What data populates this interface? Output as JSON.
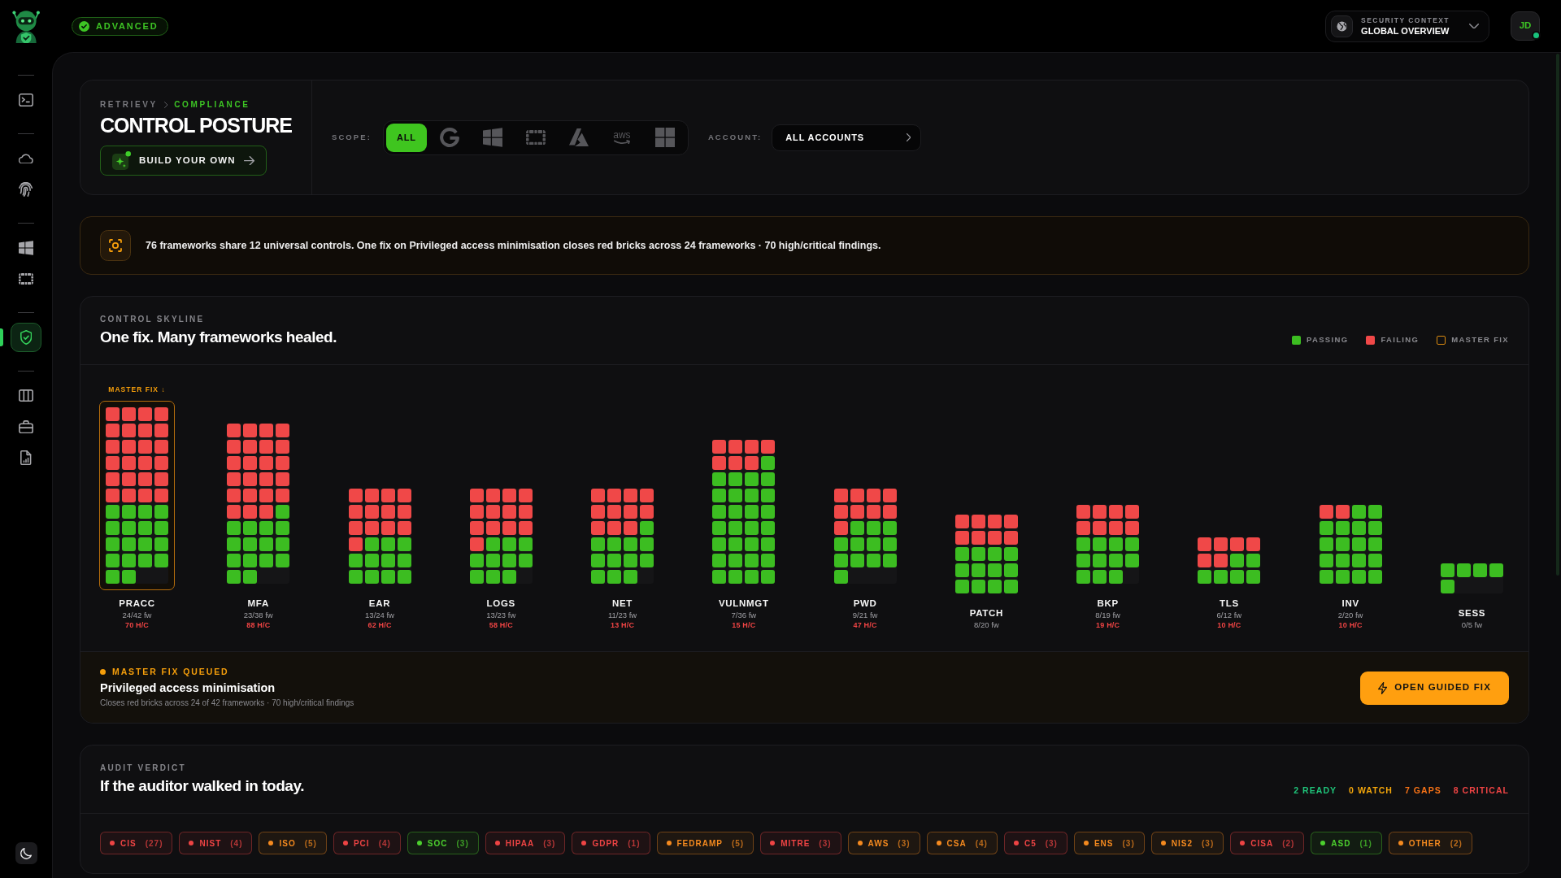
{
  "topbar": {
    "badge": "ADVANCED",
    "context": {
      "label": "SECURITY CONTEXT",
      "value": "GLOBAL OVERVIEW"
    },
    "user": {
      "initials": "JD",
      "online": true
    }
  },
  "sidebar": {
    "groups": [
      {
        "items": [
          {
            "kind": "terminal",
            "selected": false
          }
        ]
      },
      {
        "items": [
          {
            "kind": "cloud",
            "selected": false
          },
          {
            "kind": "fingerprint",
            "selected": false
          }
        ]
      },
      {
        "items": [
          {
            "kind": "panes",
            "selected": false
          },
          {
            "kind": "frame",
            "selected": false
          }
        ]
      },
      {
        "items": [
          {
            "kind": "shield",
            "selected": true
          }
        ]
      },
      {
        "items": [
          {
            "kind": "columns",
            "selected": false
          },
          {
            "kind": "briefcase",
            "selected": false
          },
          {
            "kind": "report",
            "selected": false
          }
        ]
      }
    ]
  },
  "header": {
    "breadcrumb": [
      {
        "label": "RETRIEVY",
        "current": false
      },
      {
        "label": "COMPLIANCE",
        "current": true
      }
    ],
    "title": "CONTROL POSTURE",
    "build_button": "BUILD YOUR OWN",
    "scope": {
      "label": "SCOPE:",
      "options": [
        {
          "kind": "all",
          "label": "ALL",
          "selected": true
        },
        {
          "kind": "g",
          "selected": false
        },
        {
          "kind": "panes",
          "selected": false
        },
        {
          "kind": "frame",
          "selected": false
        },
        {
          "kind": "peak",
          "selected": false
        },
        {
          "kind": "smile",
          "label": "aws",
          "selected": false
        },
        {
          "kind": "squares",
          "selected": false
        }
      ]
    },
    "account": {
      "label": "ACCOUNT:",
      "value": "ALL ACCOUNTS"
    }
  },
  "insight": {
    "text": "76 frameworks share 12 universal controls. One fix on Privileged access minimisation closes red bricks across 24 frameworks · 70 high/critical findings."
  },
  "skyline": {
    "eyebrow": "CONTROL SKYLINE",
    "title": "One fix. Many frameworks healed.",
    "legend": [
      {
        "label": "PASSING",
        "kind": "passing"
      },
      {
        "label": "FAILING",
        "kind": "failing"
      },
      {
        "label": "MASTER FIX",
        "kind": "master_fix"
      }
    ],
    "master_fix_tag": "MASTER FIX ↓",
    "controls": [
      {
        "code": "PRACC",
        "frameworks": "24/42 fw",
        "findings": "70 H/C",
        "master_fix": true,
        "bricks": [
          {
            "failing": true
          },
          {
            "failing": true
          },
          {
            "failing": true
          },
          {
            "failing": true
          },
          {
            "failing": true
          },
          {
            "failing": true
          },
          {
            "failing": true
          },
          {
            "failing": true
          },
          {
            "failing": true
          },
          {
            "failing": true
          },
          {
            "failing": true
          },
          {
            "failing": true
          },
          {
            "failing": true
          },
          {
            "failing": true
          },
          {
            "failing": true
          },
          {
            "failing": true
          },
          {
            "failing": true
          },
          {
            "failing": true
          },
          {
            "failing": true
          },
          {
            "failing": true
          },
          {
            "failing": true
          },
          {
            "failing": true
          },
          {
            "failing": true
          },
          {
            "failing": true
          },
          {
            "failing": false
          },
          {
            "failing": false
          },
          {
            "failing": false
          },
          {
            "failing": false
          },
          {
            "failing": false
          },
          {
            "failing": false
          },
          {
            "failing": false
          },
          {
            "failing": false
          },
          {
            "failing": false
          },
          {
            "failing": false
          },
          {
            "failing": false
          },
          {
            "failing": false
          },
          {
            "failing": false
          },
          {
            "failing": false
          },
          {
            "failing": false
          },
          {
            "failing": false
          },
          {
            "failing": false
          },
          {
            "failing": false
          }
        ]
      },
      {
        "code": "MFA",
        "frameworks": "23/38 fw",
        "findings": "88 H/C",
        "master_fix": false,
        "bricks": [
          {
            "failing": true
          },
          {
            "failing": true
          },
          {
            "failing": true
          },
          {
            "failing": true
          },
          {
            "failing": true
          },
          {
            "failing": true
          },
          {
            "failing": true
          },
          {
            "failing": true
          },
          {
            "failing": true
          },
          {
            "failing": true
          },
          {
            "failing": true
          },
          {
            "failing": true
          },
          {
            "failing": true
          },
          {
            "failing": true
          },
          {
            "failing": true
          },
          {
            "failing": true
          },
          {
            "failing": true
          },
          {
            "failing": true
          },
          {
            "failing": true
          },
          {
            "failing": true
          },
          {
            "failing": true
          },
          {
            "failing": true
          },
          {
            "failing": true
          },
          {
            "failing": false
          },
          {
            "failing": false
          },
          {
            "failing": false
          },
          {
            "failing": false
          },
          {
            "failing": false
          },
          {
            "failing": false
          },
          {
            "failing": false
          },
          {
            "failing": false
          },
          {
            "failing": false
          },
          {
            "failing": false
          },
          {
            "failing": false
          },
          {
            "failing": false
          },
          {
            "failing": false
          },
          {
            "failing": false
          },
          {
            "failing": false
          }
        ]
      },
      {
        "code": "EAR",
        "frameworks": "13/24 fw",
        "findings": "62 H/C",
        "master_fix": false,
        "bricks": [
          {
            "failing": true
          },
          {
            "failing": true
          },
          {
            "failing": true
          },
          {
            "failing": true
          },
          {
            "failing": true
          },
          {
            "failing": true
          },
          {
            "failing": true
          },
          {
            "failing": true
          },
          {
            "failing": true
          },
          {
            "failing": true
          },
          {
            "failing": true
          },
          {
            "failing": true
          },
          {
            "failing": true
          },
          {
            "failing": false
          },
          {
            "failing": false
          },
          {
            "failing": false
          },
          {
            "failing": false
          },
          {
            "failing": false
          },
          {
            "failing": false
          },
          {
            "failing": false
          },
          {
            "failing": false
          },
          {
            "failing": false
          },
          {
            "failing": false
          },
          {
            "failing": false
          }
        ]
      },
      {
        "code": "LOGS",
        "frameworks": "13/23 fw",
        "findings": "58 H/C",
        "master_fix": false,
        "bricks": [
          {
            "failing": true
          },
          {
            "failing": true
          },
          {
            "failing": true
          },
          {
            "failing": true
          },
          {
            "failing": true
          },
          {
            "failing": true
          },
          {
            "failing": true
          },
          {
            "failing": true
          },
          {
            "failing": true
          },
          {
            "failing": true
          },
          {
            "failing": true
          },
          {
            "failing": true
          },
          {
            "failing": true
          },
          {
            "failing": false
          },
          {
            "failing": false
          },
          {
            "failing": false
          },
          {
            "failing": false
          },
          {
            "failing": false
          },
          {
            "failing": false
          },
          {
            "failing": false
          },
          {
            "failing": false
          },
          {
            "failing": false
          },
          {
            "failing": false
          }
        ]
      },
      {
        "code": "NET",
        "frameworks": "11/23 fw",
        "findings": "13 H/C",
        "master_fix": false,
        "bricks": [
          {
            "failing": true
          },
          {
            "failing": true
          },
          {
            "failing": true
          },
          {
            "failing": true
          },
          {
            "failing": true
          },
          {
            "failing": true
          },
          {
            "failing": true
          },
          {
            "failing": true
          },
          {
            "failing": true
          },
          {
            "failing": true
          },
          {
            "failing": true
          },
          {
            "failing": false
          },
          {
            "failing": false
          },
          {
            "failing": false
          },
          {
            "failing": false
          },
          {
            "failing": false
          },
          {
            "failing": false
          },
          {
            "failing": false
          },
          {
            "failing": false
          },
          {
            "failing": false
          },
          {
            "failing": false
          },
          {
            "failing": false
          },
          {
            "failing": false
          }
        ]
      },
      {
        "code": "VULNMGT",
        "frameworks": "7/36 fw",
        "findings": "15 H/C",
        "master_fix": false,
        "bricks": [
          {
            "failing": true
          },
          {
            "failing": true
          },
          {
            "failing": true
          },
          {
            "failing": true
          },
          {
            "failing": true
          },
          {
            "failing": true
          },
          {
            "failing": true
          },
          {
            "failing": false
          },
          {
            "failing": false
          },
          {
            "failing": false
          },
          {
            "failing": false
          },
          {
            "failing": false
          },
          {
            "failing": false
          },
          {
            "failing": false
          },
          {
            "failing": false
          },
          {
            "failing": false
          },
          {
            "failing": false
          },
          {
            "failing": false
          },
          {
            "failing": false
          },
          {
            "failing": false
          },
          {
            "failing": false
          },
          {
            "failing": false
          },
          {
            "failing": false
          },
          {
            "failing": false
          },
          {
            "failing": false
          },
          {
            "failing": false
          },
          {
            "failing": false
          },
          {
            "failing": false
          },
          {
            "failing": false
          },
          {
            "failing": false
          },
          {
            "failing": false
          },
          {
            "failing": false
          },
          {
            "failing": false
          },
          {
            "failing": false
          },
          {
            "failing": false
          },
          {
            "failing": false
          }
        ]
      },
      {
        "code": "PWD",
        "frameworks": "9/21 fw",
        "findings": "47 H/C",
        "master_fix": false,
        "bricks": [
          {
            "failing": true
          },
          {
            "failing": true
          },
          {
            "failing": true
          },
          {
            "failing": true
          },
          {
            "failing": true
          },
          {
            "failing": true
          },
          {
            "failing": true
          },
          {
            "failing": true
          },
          {
            "failing": true
          },
          {
            "failing": false
          },
          {
            "failing": false
          },
          {
            "failing": false
          },
          {
            "failing": false
          },
          {
            "failing": false
          },
          {
            "failing": false
          },
          {
            "failing": false
          },
          {
            "failing": false
          },
          {
            "failing": false
          },
          {
            "failing": false
          },
          {
            "failing": false
          },
          {
            "failing": false
          }
        ]
      },
      {
        "code": "PATCH",
        "frameworks": "8/20 fw",
        "master_fix": false,
        "bricks": [
          {
            "failing": true
          },
          {
            "failing": true
          },
          {
            "failing": true
          },
          {
            "failing": true
          },
          {
            "failing": true
          },
          {
            "failing": true
          },
          {
            "failing": true
          },
          {
            "failing": true
          },
          {
            "failing": false
          },
          {
            "failing": false
          },
          {
            "failing": false
          },
          {
            "failing": false
          },
          {
            "failing": false
          },
          {
            "failing": false
          },
          {
            "failing": false
          },
          {
            "failing": false
          },
          {
            "failing": false
          },
          {
            "failing": false
          },
          {
            "failing": false
          },
          {
            "failing": false
          }
        ]
      },
      {
        "code": "BKP",
        "frameworks": "8/19 fw",
        "findings": "19 H/C",
        "master_fix": false,
        "bricks": [
          {
            "failing": true
          },
          {
            "failing": true
          },
          {
            "failing": true
          },
          {
            "failing": true
          },
          {
            "failing": true
          },
          {
            "failing": true
          },
          {
            "failing": true
          },
          {
            "failing": true
          },
          {
            "failing": false
          },
          {
            "failing": false
          },
          {
            "failing": false
          },
          {
            "failing": false
          },
          {
            "failing": false
          },
          {
            "failing": false
          },
          {
            "failing": false
          },
          {
            "failing": false
          },
          {
            "failing": false
          },
          {
            "failing": false
          },
          {
            "failing": false
          }
        ]
      },
      {
        "code": "TLS",
        "frameworks": "6/12 fw",
        "findings": "10 H/C",
        "master_fix": false,
        "bricks": [
          {
            "failing": true
          },
          {
            "failing": true
          },
          {
            "failing": true
          },
          {
            "failing": true
          },
          {
            "failing": true
          },
          {
            "failing": true
          },
          {
            "failing": false
          },
          {
            "failing": false
          },
          {
            "failing": false
          },
          {
            "failing": false
          },
          {
            "failing": false
          },
          {
            "failing": false
          }
        ]
      },
      {
        "code": "INV",
        "frameworks": "2/20 fw",
        "findings": "10 H/C",
        "master_fix": false,
        "bricks": [
          {
            "failing": true
          },
          {
            "failing": true
          },
          {
            "failing": false
          },
          {
            "failing": false
          },
          {
            "failing": false
          },
          {
            "failing": false
          },
          {
            "failing": false
          },
          {
            "failing": false
          },
          {
            "failing": false
          },
          {
            "failing": false
          },
          {
            "failing": false
          },
          {
            "failing": false
          },
          {
            "failing": false
          },
          {
            "failing": false
          },
          {
            "failing": false
          },
          {
            "failing": false
          },
          {
            "failing": false
          },
          {
            "failing": false
          },
          {
            "failing": false
          },
          {
            "failing": false
          }
        ]
      },
      {
        "code": "SESS",
        "frameworks": "0/5 fw",
        "master_fix": false,
        "bricks": [
          {
            "failing": false
          },
          {
            "failing": false
          },
          {
            "failing": false
          },
          {
            "failing": false
          },
          {
            "failing": false
          }
        ]
      }
    ],
    "queued": {
      "label": "MASTER FIX QUEUED",
      "title": "Privileged access minimisation",
      "detail": "Closes red bricks across 24 of 42 frameworks · 70 high/critical findings",
      "button": "OPEN GUIDED FIX"
    }
  },
  "audit": {
    "eyebrow": "AUDIT VERDICT",
    "title": "If the auditor walked in today.",
    "summary": [
      {
        "text": "2 READY",
        "color": "#1fc47a"
      },
      {
        "text": "0 WATCH",
        "color": "#f5a70b"
      },
      {
        "text": "7 GAPS",
        "color": "#f97316"
      },
      {
        "text": "8 CRITICAL",
        "color": "#ef4444"
      }
    ],
    "frameworks": [
      {
        "label": "CIS",
        "count": "(27)",
        "color": "#ef4444"
      },
      {
        "label": "NIST",
        "count": "(4)",
        "color": "#ef4444"
      },
      {
        "label": "ISO",
        "count": "(5)",
        "color": "#f58a1f"
      },
      {
        "label": "PCI",
        "count": "(4)",
        "color": "#ef4444"
      },
      {
        "label": "SOC",
        "count": "(3)",
        "color": "#4ccf2e"
      },
      {
        "label": "HIPAA",
        "count": "(3)",
        "color": "#ef4444"
      },
      {
        "label": "GDPR",
        "count": "(1)",
        "color": "#ef4444"
      },
      {
        "label": "FEDRAMP",
        "count": "(5)",
        "color": "#f58a1f"
      },
      {
        "label": "MITRE",
        "count": "(3)",
        "color": "#ef4444"
      },
      {
        "label": "AWS",
        "count": "(3)",
        "color": "#f58a1f"
      },
      {
        "label": "CSA",
        "count": "(4)",
        "color": "#f58a1f"
      },
      {
        "label": "C5",
        "count": "(3)",
        "color": "#ef4444"
      },
      {
        "label": "ENS",
        "count": "(3)",
        "color": "#f58a1f"
      },
      {
        "label": "NIS2",
        "count": "(3)",
        "color": "#f58a1f"
      },
      {
        "label": "CISA",
        "count": "(2)",
        "color": "#ef4444"
      },
      {
        "label": "ASD",
        "count": "(1)",
        "color": "#4ccf2e"
      },
      {
        "label": "OTHER",
        "count": "(2)",
        "color": "#f58a1f"
      }
    ]
  }
}
